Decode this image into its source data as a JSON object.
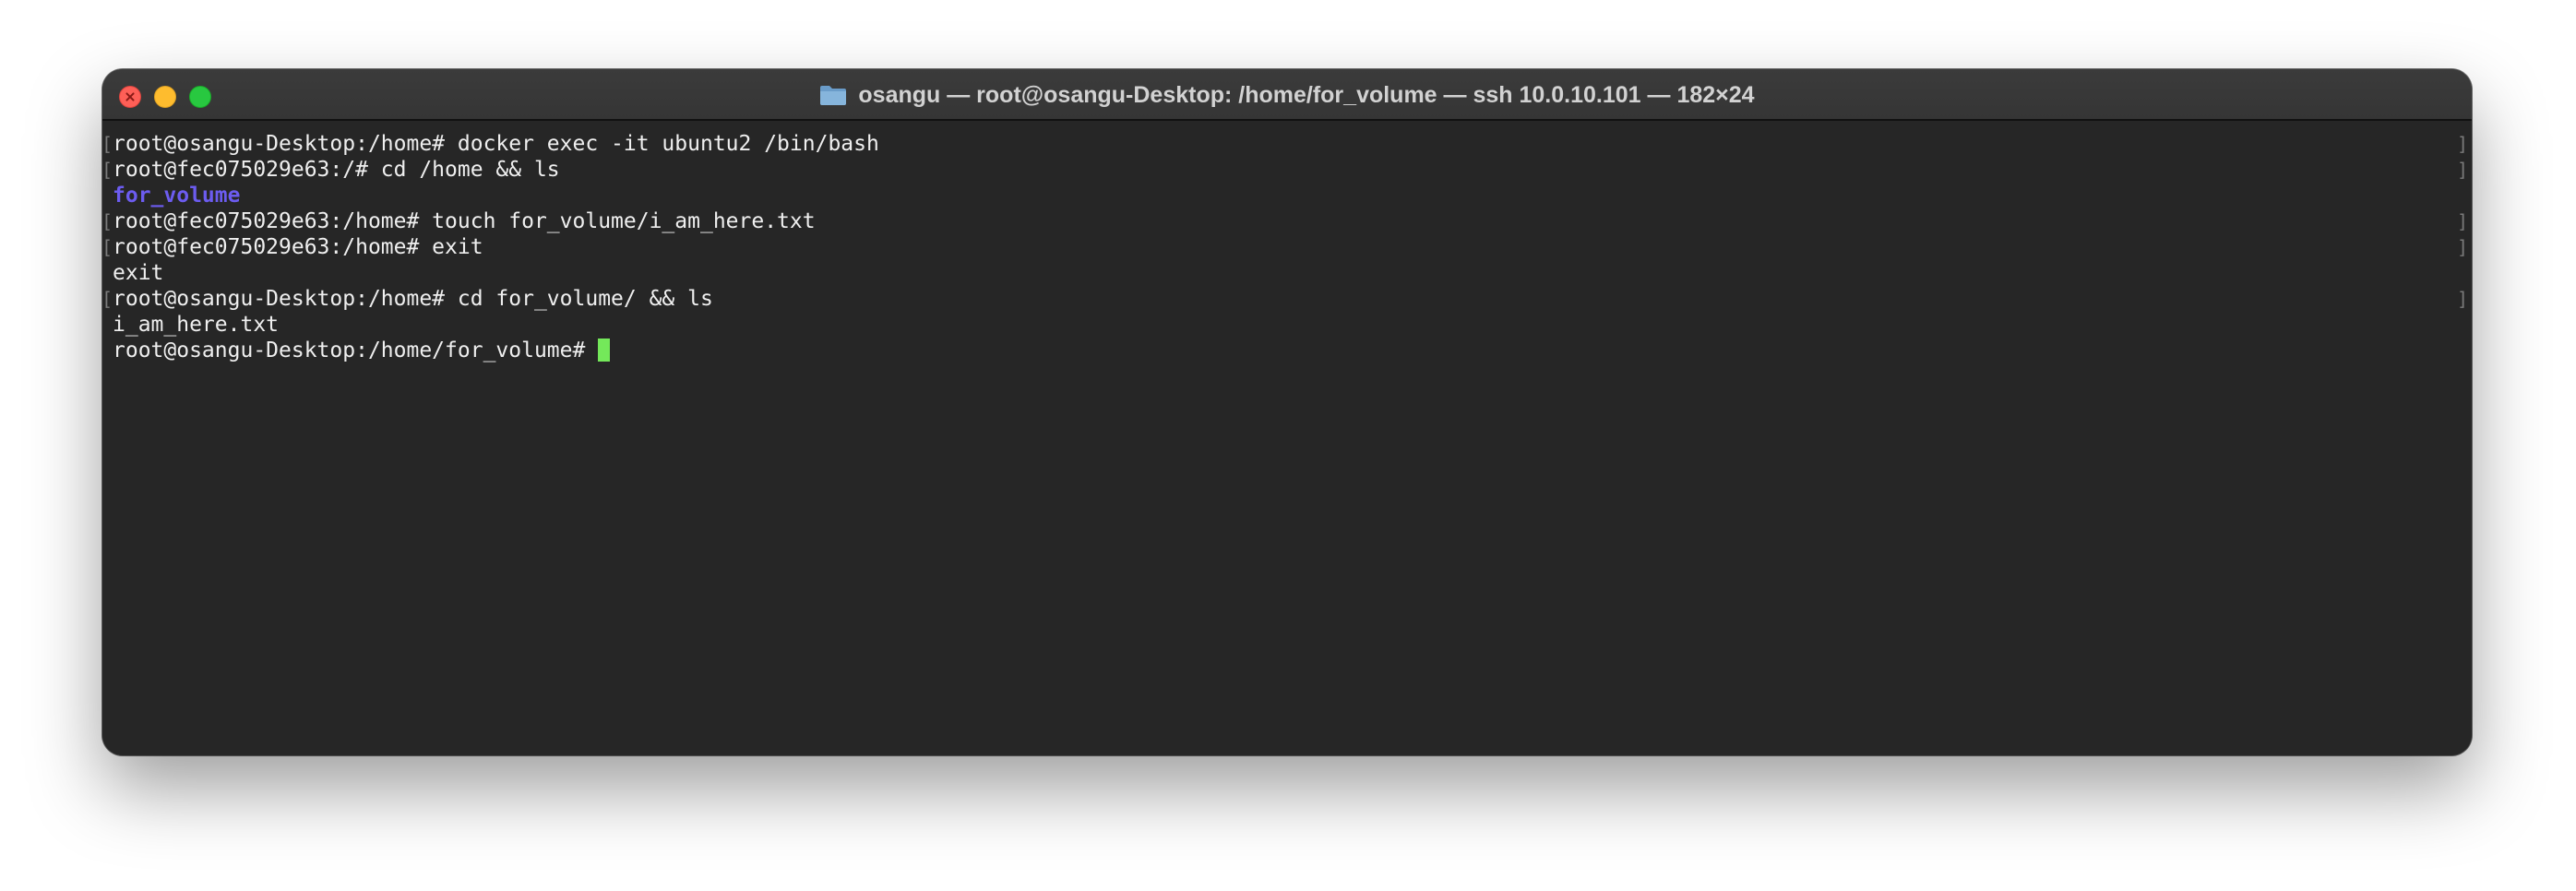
{
  "window": {
    "title": "osangu — root@osangu-Desktop: /home/for_volume — ssh 10.0.10.101 — 182×24",
    "folder_icon": "folder-icon"
  },
  "colors": {
    "background": "#262626",
    "text": "#efefef",
    "directory": "#6c5cf0",
    "cursor": "#74e85a"
  },
  "terminal": {
    "lines": [
      {
        "text": "root@osangu-Desktop:/home# docker exec -it ubuntu2 /bin/bash",
        "marked": true
      },
      {
        "text": "root@fec075029e63:/# cd /home && ls",
        "marked": true
      },
      {
        "text": "for_volume",
        "marked": false,
        "kind": "directory"
      },
      {
        "text": "root@fec075029e63:/home# touch for_volume/i_am_here.txt",
        "marked": true
      },
      {
        "text": "root@fec075029e63:/home# exit",
        "marked": true
      },
      {
        "text": "exit",
        "marked": false
      },
      {
        "text": "root@osangu-Desktop:/home# cd for_volume/ && ls",
        "marked": true
      },
      {
        "text": "i_am_here.txt",
        "marked": false
      },
      {
        "text": "root@osangu-Desktop:/home/for_volume#",
        "marked": false,
        "prompt": true
      }
    ]
  }
}
